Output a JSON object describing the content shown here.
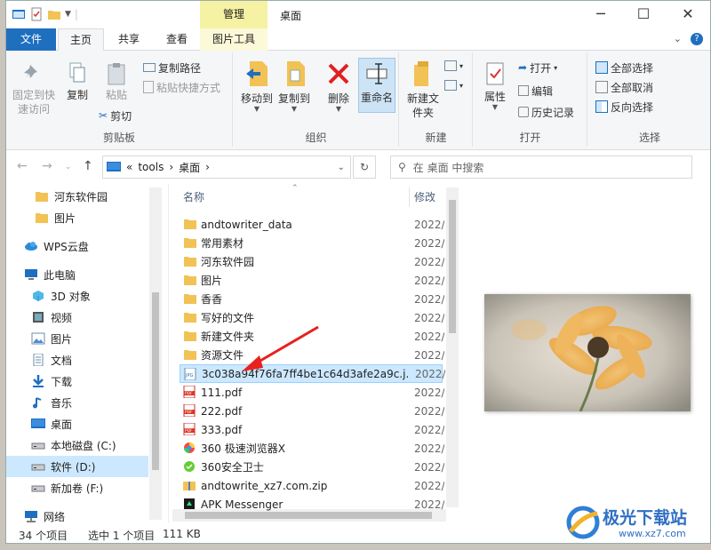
{
  "window": {
    "title": "桌面",
    "context_tab_top": "管理"
  },
  "tabs": {
    "file": "文件",
    "home": "主页",
    "share": "共享",
    "view": "查看",
    "picture_tools": "图片工具"
  },
  "ribbon": {
    "clipboard": {
      "pin_label": "固定到快速访问",
      "copy_label": "复制",
      "paste_label": "粘贴",
      "copy_path": "复制路径",
      "paste_shortcut": "粘贴快捷方式",
      "cut": "剪切",
      "group_label": "剪贴板"
    },
    "organize": {
      "move_to": "移动到",
      "copy_to": "复制到",
      "delete": "删除",
      "rename": "重命名",
      "group_label": "组织"
    },
    "new": {
      "new_folder": "新建文件夹",
      "group_label": "新建"
    },
    "open": {
      "properties": "属性",
      "open": "打开",
      "edit": "编辑",
      "history": "历史记录",
      "group_label": "打开"
    },
    "select": {
      "select_all": "全部选择",
      "select_none": "全部取消",
      "invert": "反向选择",
      "group_label": "选择"
    }
  },
  "address": {
    "prefix": "«",
    "crumb1": "tools",
    "crumb2": "桌面",
    "search_placeholder": "在 桌面 中搜索"
  },
  "navpane": {
    "items": [
      {
        "label": "河东软件园",
        "icon": "folder-icon"
      },
      {
        "label": "图片",
        "icon": "folder-icon"
      },
      {
        "label": "WPS云盘",
        "icon": "cloud-icon"
      },
      {
        "label": "此电脑",
        "icon": "pc-icon"
      },
      {
        "label": "3D 对象",
        "icon": "cube-icon"
      },
      {
        "label": "视频",
        "icon": "video-icon"
      },
      {
        "label": "图片",
        "icon": "pictures-icon"
      },
      {
        "label": "文档",
        "icon": "document-icon"
      },
      {
        "label": "下载",
        "icon": "download-icon"
      },
      {
        "label": "音乐",
        "icon": "music-icon"
      },
      {
        "label": "桌面",
        "icon": "desktop-icon"
      },
      {
        "label": "本地磁盘 (C:)",
        "icon": "drive-icon"
      },
      {
        "label": "软件 (D:)",
        "icon": "drive-icon"
      },
      {
        "label": "新加卷 (F:)",
        "icon": "drive-icon"
      },
      {
        "label": "网络",
        "icon": "network-icon"
      }
    ]
  },
  "filelist": {
    "col_name": "名称",
    "col_date": "修改日",
    "files": [
      {
        "name": "andtowriter_data",
        "date": "2022/",
        "icon": "folder-icon"
      },
      {
        "name": "常用素材",
        "date": "2022/",
        "icon": "folder-icon"
      },
      {
        "name": "河东软件园",
        "date": "2022/",
        "icon": "folder-icon"
      },
      {
        "name": "图片",
        "date": "2022/",
        "icon": "folder-icon"
      },
      {
        "name": "香香",
        "date": "2022/",
        "icon": "folder-icon"
      },
      {
        "name": "写好的文件",
        "date": "2022/",
        "icon": "folder-icon"
      },
      {
        "name": "新建文件夹",
        "date": "2022/",
        "icon": "folder-icon"
      },
      {
        "name": "资源文件",
        "date": "2022/",
        "icon": "folder-icon"
      },
      {
        "name": "3c038a94f76fa7ff4be1c64d3afe2a9c.j...",
        "date": "2022/",
        "icon": "jpg-icon"
      },
      {
        "name": "111.pdf",
        "date": "2022/",
        "icon": "pdf-icon"
      },
      {
        "name": "222.pdf",
        "date": "2022/",
        "icon": "pdf-icon"
      },
      {
        "name": "333.pdf",
        "date": "2022/",
        "icon": "pdf-icon"
      },
      {
        "name": "360 极速浏览器X",
        "date": "2022/",
        "icon": "browser-icon"
      },
      {
        "name": "360安全卫士",
        "date": "2022/",
        "icon": "shield-icon"
      },
      {
        "name": "andtowrite_xz7.com.zip",
        "date": "2022/",
        "icon": "zip-icon"
      },
      {
        "name": "APK Messenger",
        "date": "2022/",
        "icon": "app-icon"
      }
    ]
  },
  "status": {
    "count": "34 个项目",
    "selected": "选中 1 个项目",
    "size": "111 KB"
  },
  "watermark": {
    "text": "极光下载站",
    "url": "www.xz7.com"
  },
  "colors": {
    "accent": "#1f6fbf",
    "selection": "#cce8ff",
    "context_tab": "#f6f2a4",
    "folder": "#f2c255"
  }
}
